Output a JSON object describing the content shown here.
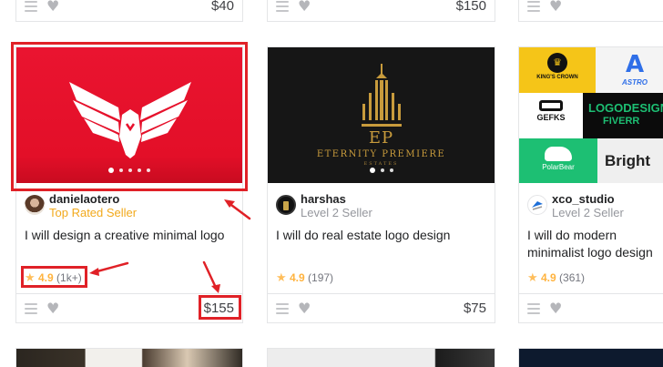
{
  "top_row": [
    {
      "price": "$40"
    },
    {
      "price": "$150"
    },
    {
      "price": ""
    }
  ],
  "gigs": [
    {
      "seller": "danielaotero",
      "level": "Top Rated Seller",
      "title": "I will design a creative minimal logo",
      "rating": "4.9",
      "reviews": "(1k+)",
      "price": "$155",
      "image_color": "#e8112d"
    },
    {
      "seller": "harshas",
      "level": "Level 2 Seller",
      "title": "I will do real estate logo design",
      "rating": "4.9",
      "reviews": "(197)",
      "price": "$75",
      "image_color": "#151515",
      "brand_main": "ETERNITY PREMIERE",
      "brand_sub": "ESTATES",
      "brand_mono": "EP"
    },
    {
      "seller": "xco_studio",
      "level": "Level 2 Seller",
      "title": "I will do modern minimalist logo design",
      "rating": "4.9",
      "reviews": "(361)",
      "price": "",
      "image_color": "#ffffff",
      "tiles": [
        "KING'S CROWN",
        "ASTRO",
        "GEFKS",
        "LOGODESIGN",
        "FIVERR",
        "PolarBear",
        "Bright"
      ]
    }
  ],
  "colors": {
    "top_rated": "#f2a91c",
    "star": "#ffbe5b",
    "annotation": "#e02127"
  }
}
